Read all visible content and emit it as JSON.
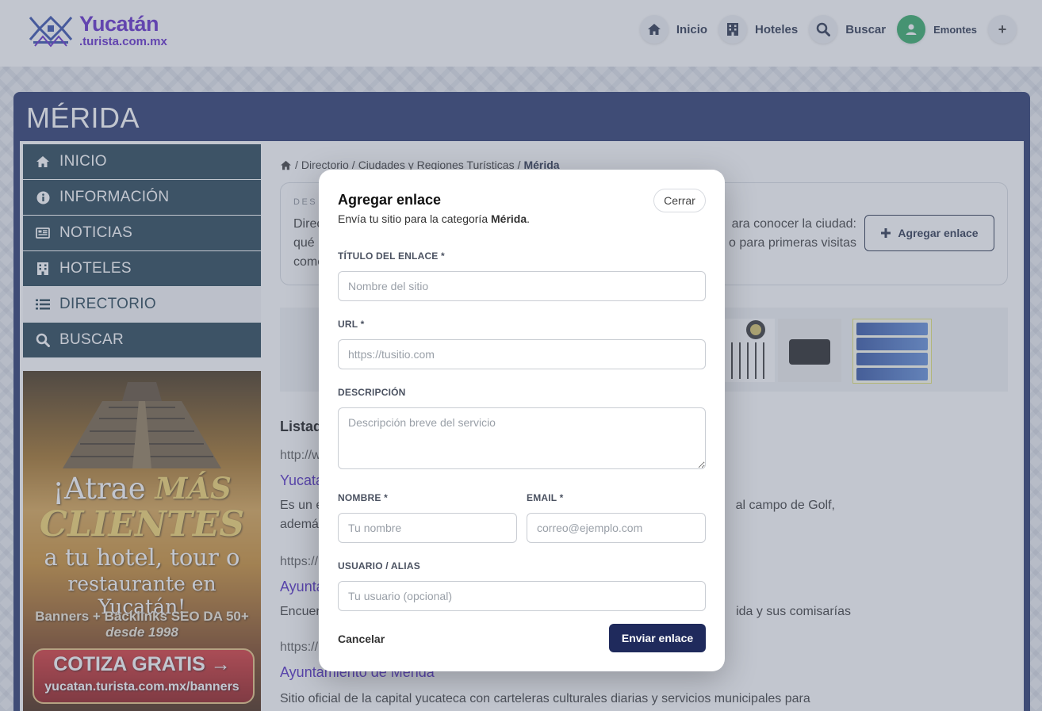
{
  "header": {
    "logo_title": "Yucatán",
    "logo_subtitle": ".turista.com.mx",
    "nav": [
      {
        "label": "Inicio",
        "icon": "home-icon"
      },
      {
        "label": "Hoteles",
        "icon": "building-icon"
      },
      {
        "label": "Buscar",
        "icon": "search-icon"
      }
    ],
    "user": "Emontes",
    "plus": "+"
  },
  "page": {
    "title": "MÉRIDA"
  },
  "sidebar": {
    "items": [
      {
        "label": "INICIO",
        "icon": "home-icon",
        "active": false
      },
      {
        "label": "INFORMACIÓN",
        "icon": "info-icon",
        "active": false
      },
      {
        "label": "NOTICIAS",
        "icon": "newspaper-icon",
        "active": false
      },
      {
        "label": "HOTELES",
        "icon": "building-icon",
        "active": false
      },
      {
        "label": "DIRECTORIO",
        "icon": "list-icon",
        "active": true
      },
      {
        "label": "BUSCAR",
        "icon": "search-icon",
        "active": false
      }
    ],
    "banner": {
      "line1": "¡Atrae",
      "line1_highlight": "MÁS",
      "line2": "CLIENTES",
      "line3": "a tu hotel, tour o",
      "line4": "restaurante en Yucatán!",
      "line5": "Banners + Backlinks SEO DA 50+",
      "line6": "desde 1998",
      "cta": "COTIZA GRATIS →",
      "url": "yucatan.turista.com.mx/banners"
    }
  },
  "breadcrumb": {
    "items": [
      "Directorio",
      "Ciudades y Regiones Turísticas"
    ],
    "current": "Mérida",
    "sep": "/"
  },
  "description": {
    "label": "DES",
    "text_start": "Direc",
    "text_end_1": "ara conocer la ciudad:",
    "text_line2_start": "qué",
    "text_end_2": "o para primeras visitas",
    "text_line3_start": "come",
    "add_link_label": "Agregar enlace"
  },
  "listing": {
    "title": "Listad",
    "entries": [
      {
        "url": "http://w",
        "name": "Yucata",
        "desc_start": "Es un e",
        "desc_end": "al campo de Golf,",
        "desc_line2": "ademá"
      },
      {
        "url": "https://",
        "name": "Ayunta",
        "desc_start": "Encuer",
        "desc_end": "ida y sus comisarías"
      },
      {
        "url": "https://",
        "name": "Ayuntamiento de Mérida",
        "desc_start": "Sitio oficial de la capital yucateca con carteleras culturales diarias y servicios municipales para"
      }
    ]
  },
  "modal": {
    "title": "Agregar enlace",
    "subtitle_prefix": "Envía tu sitio para la categoría",
    "subtitle_category": "Mérida",
    "subtitle_suffix": ".",
    "close_label": "Cerrar",
    "fields": {
      "title_label": "TÍTULO DEL ENLACE *",
      "title_placeholder": "Nombre del sitio",
      "url_label": "URL *",
      "url_placeholder": "https://tusitio.com",
      "desc_label": "DESCRIPCIÓN",
      "desc_placeholder": "Descripción breve del servicio",
      "name_label": "NOMBRE *",
      "name_placeholder": "Tu nombre",
      "email_label": "EMAIL *",
      "email_placeholder": "correo@ejemplo.com",
      "user_label": "USUARIO / ALIAS",
      "user_placeholder": "Tu usuario (opcional)"
    },
    "cancel_label": "Cancelar",
    "submit_label": "Enviar enlace"
  },
  "colors": {
    "brand_purple": "#5a20c8",
    "panel_navy": "#1e2d66",
    "sidebar_teal": "#1b3a4a",
    "submit_navy": "#1f2a5c",
    "user_green": "#2aa860"
  }
}
